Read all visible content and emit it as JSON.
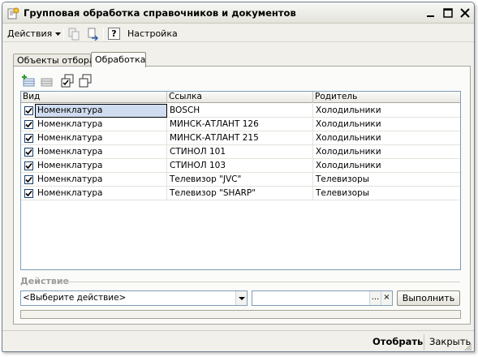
{
  "window": {
    "title": "Групповая обработка справочников и документов"
  },
  "toolbar": {
    "actions_label": "Действия",
    "settings_label": "Настройка",
    "help_label": "?"
  },
  "tabs": [
    {
      "label": "Объекты отбора",
      "active": false
    },
    {
      "label": "Обработка",
      "active": true
    }
  ],
  "table": {
    "columns": [
      "Вид",
      "Ссылка",
      "Родитель"
    ],
    "rows": [
      {
        "checked": true,
        "vid": "Номенклатура",
        "ssylka": "BOSCH",
        "roditel": "Холодильники"
      },
      {
        "checked": true,
        "vid": "Номенклатура",
        "ssylka": "МИНСК-АТЛАНТ 126",
        "roditel": "Холодильники"
      },
      {
        "checked": true,
        "vid": "Номенклатура",
        "ssylka": "МИНСК-АТЛАНТ 215",
        "roditel": "Холодильники"
      },
      {
        "checked": true,
        "vid": "Номенклатура",
        "ssylka": "СТИНОЛ 101",
        "roditel": "Холодильники"
      },
      {
        "checked": true,
        "vid": "Номенклатура",
        "ssylka": "СТИНОЛ 103",
        "roditel": "Холодильники"
      },
      {
        "checked": true,
        "vid": "Номенклатура",
        "ssylka": "Телевизор \"JVC\"",
        "roditel": "Телевизоры"
      },
      {
        "checked": true,
        "vid": "Номенклатура",
        "ssylka": "Телевизор \"SHARP\"",
        "roditel": "Телевизоры"
      }
    ]
  },
  "action": {
    "label": "Действие",
    "select_value": "<Выберите действие>",
    "field_value": "",
    "field_btn_select": "...",
    "field_btn_clear": "×",
    "run_label": "Выполнить"
  },
  "bottom": {
    "select_label": "Отобрать",
    "close_label": "Закрыть"
  },
  "colors": {
    "selection": "#d0dcef",
    "panel_bg": "#f1f0ea"
  }
}
